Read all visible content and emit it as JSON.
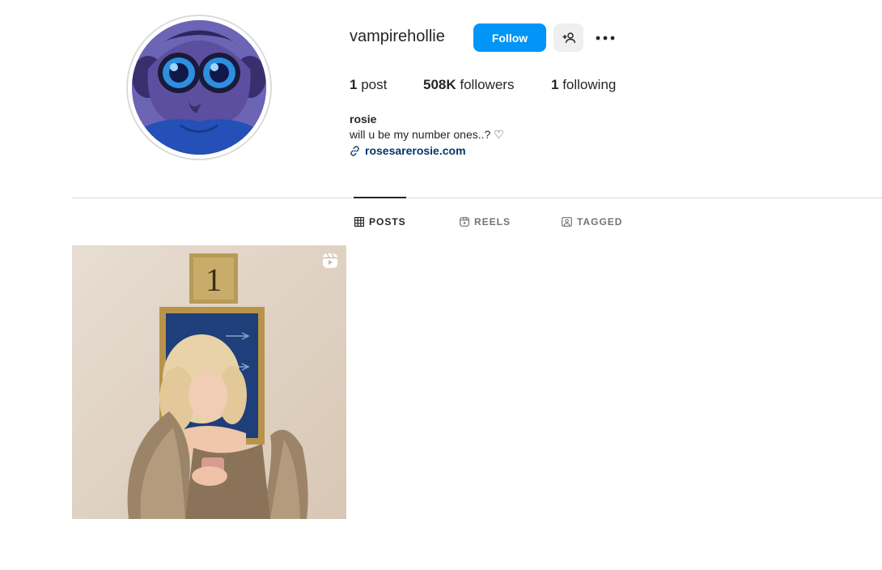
{
  "profile": {
    "username": "vampirehollie",
    "follow_label": "Follow",
    "stats": {
      "posts_count": "1",
      "posts_label": "post",
      "followers_count": "508K",
      "followers_label": "followers",
      "following_count": "1",
      "following_label": "following"
    },
    "bio": {
      "name": "rosie",
      "text": "will u be my number ones..? ♡",
      "link": "rosesarerosie.com"
    }
  },
  "tabs": [
    {
      "label": "POSTS",
      "icon": "grid-icon",
      "active": true
    },
    {
      "label": "REELS",
      "icon": "reels-icon",
      "active": false
    },
    {
      "label": "TAGGED",
      "icon": "tagged-icon",
      "active": false
    }
  ],
  "posts": [
    {
      "type": "reel",
      "icon": "reel-badge-icon",
      "sign_text": "1"
    }
  ],
  "colors": {
    "follow_button": "#0095f6",
    "link": "#00376b",
    "divider": "#dbdbdb"
  }
}
